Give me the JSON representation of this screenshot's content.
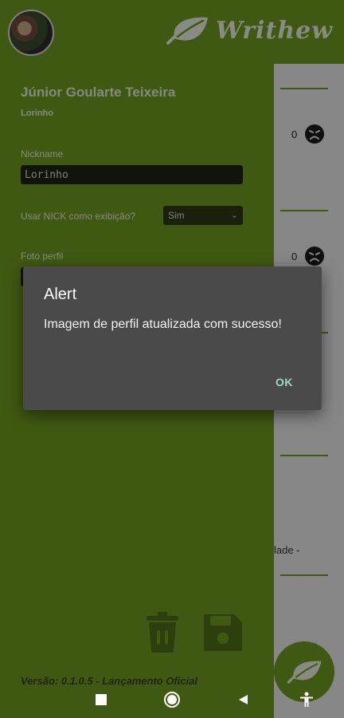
{
  "app": {
    "brand_name": "Writhew"
  },
  "profile": {
    "full_name": "Júnior Goularte Teixeira",
    "nickname_display": "Lorinho",
    "nickname_label": "Nickname",
    "nickname_value": "Lorinho",
    "use_nick_label": "Usar NICK como exibição?",
    "use_nick_value": "Sim",
    "photo_label": "Foto perfil"
  },
  "feed": {
    "items": [
      {
        "count": "0",
        "icon": "frown-face-icon"
      },
      {
        "count": "0",
        "icon": "frown-face-icon"
      }
    ],
    "partial_text": "lade -"
  },
  "footer": {
    "version": "Versão: 0.1.0.5 - Lançamento Oficial"
  },
  "actions": {
    "delete": "trash-icon",
    "save": "floppy-disk-icon"
  },
  "dialog": {
    "title": "Alert",
    "message": "Imagem de perfil atualizada com sucesso!",
    "ok_label": "OK"
  },
  "colors": {
    "brand_green": "#6f9a1f",
    "dialog_bg": "#4a4a4a",
    "accent": "#9ed9c8"
  }
}
